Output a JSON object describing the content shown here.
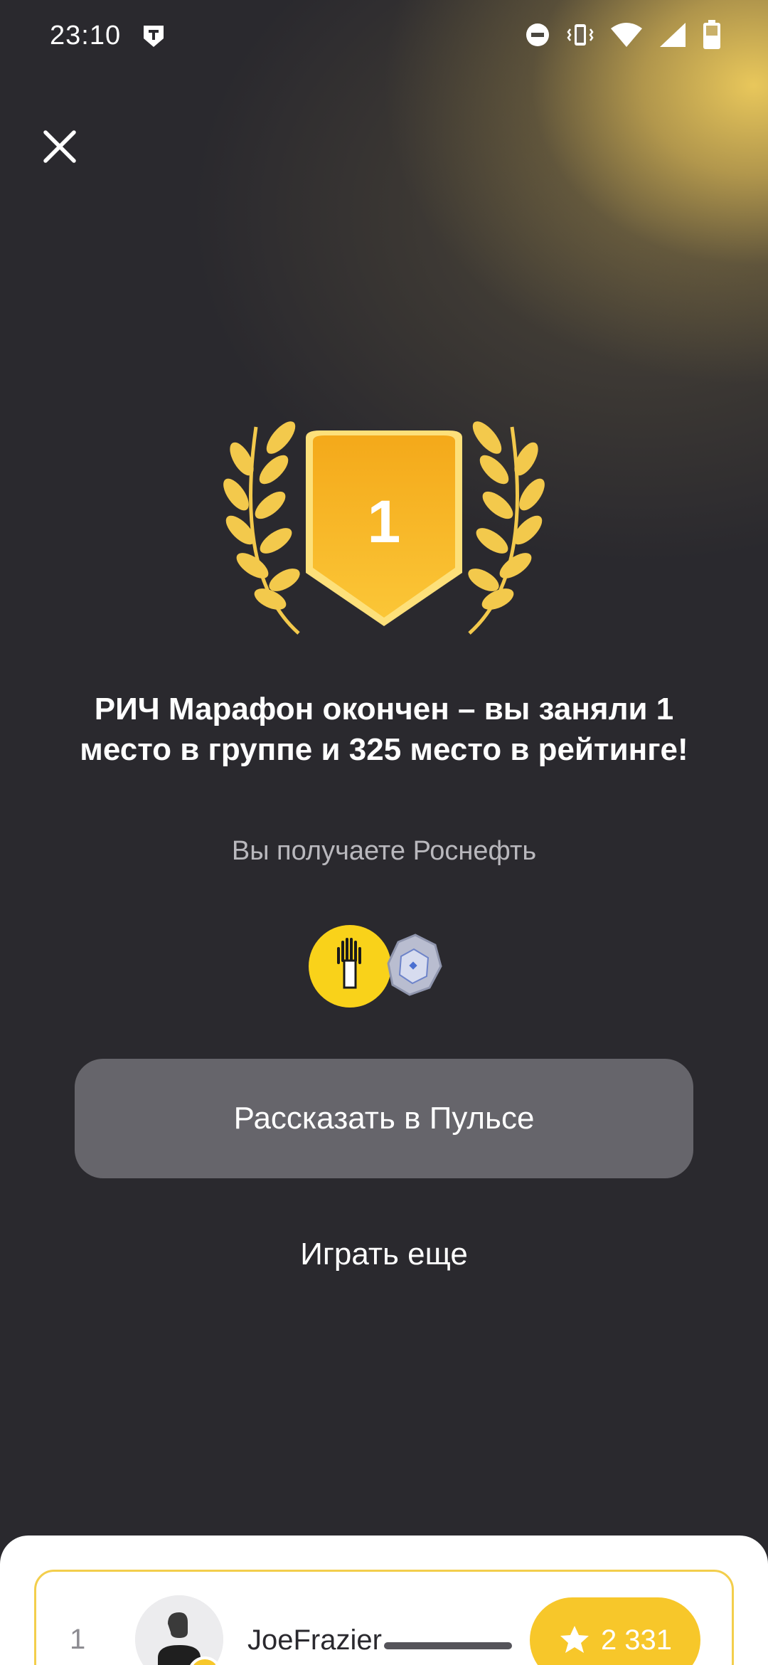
{
  "status_bar": {
    "time": "23:10",
    "icons": [
      "app-t-icon",
      "dnd-icon",
      "vibrate-icon",
      "wifi-icon",
      "signal-icon",
      "battery-icon"
    ]
  },
  "close_icon": "close-icon",
  "badge": {
    "place": "1",
    "colors": {
      "gold": "#f7b925",
      "laurel": "#f3c94c"
    }
  },
  "result": {
    "headline": "РИЧ Марафон окончен – вы заняли 1 место в группе и 325 место в рейтинге!",
    "reward_text": "Вы получаете Роснефть",
    "reward_icons": [
      "rosneft-logo-icon",
      "silver-gem-icon"
    ]
  },
  "buttons": {
    "share_label": "Рассказать в Пульсе",
    "play_again_label": "Играть еще"
  },
  "leaderboard": {
    "rows": [
      {
        "rank": "1",
        "name": "JoeFrazier",
        "score": "2 331",
        "score_icon": "star-icon"
      }
    ]
  },
  "colors": {
    "background": "#2a292e",
    "accent": "#f7c72a",
    "button_bg": "#66656b"
  }
}
